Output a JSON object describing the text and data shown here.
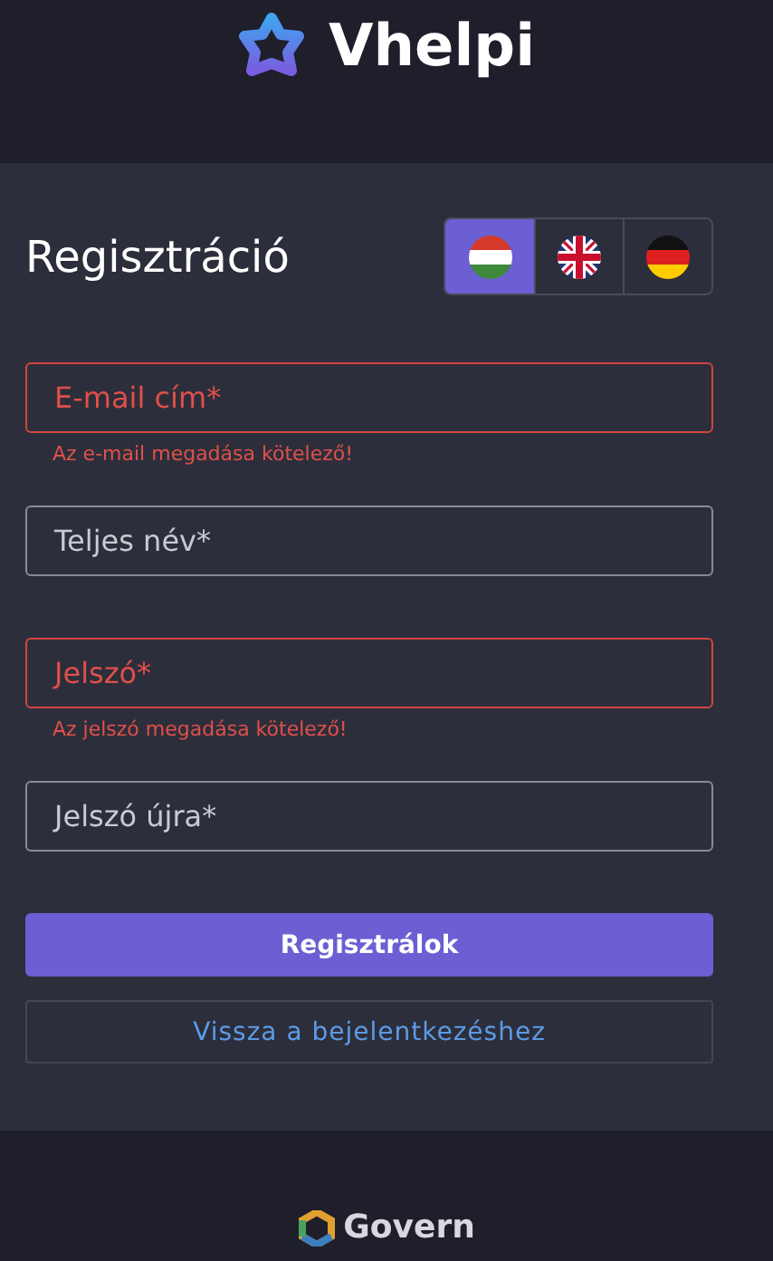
{
  "brand": "Vhelpi",
  "title": "Regisztráció",
  "languages": [
    {
      "kind": "hu",
      "selected": true
    },
    {
      "kind": "gb",
      "selected": false
    },
    {
      "kind": "de",
      "selected": false
    }
  ],
  "fields": [
    {
      "placeholder": "E-mail cím*",
      "error": true,
      "error_text": "Az e-mail megadása kötelező!"
    },
    {
      "placeholder": "Teljes név*",
      "error": false
    },
    {
      "placeholder": "Jelszó*",
      "error": true,
      "error_text": "Az jelszó megadása kötelező!"
    },
    {
      "placeholder": "Jelszó újra*",
      "error": false
    }
  ],
  "submit": "Regisztrálok",
  "back_link": "Vissza a bejelentkezéshez",
  "footer": "Govern"
}
